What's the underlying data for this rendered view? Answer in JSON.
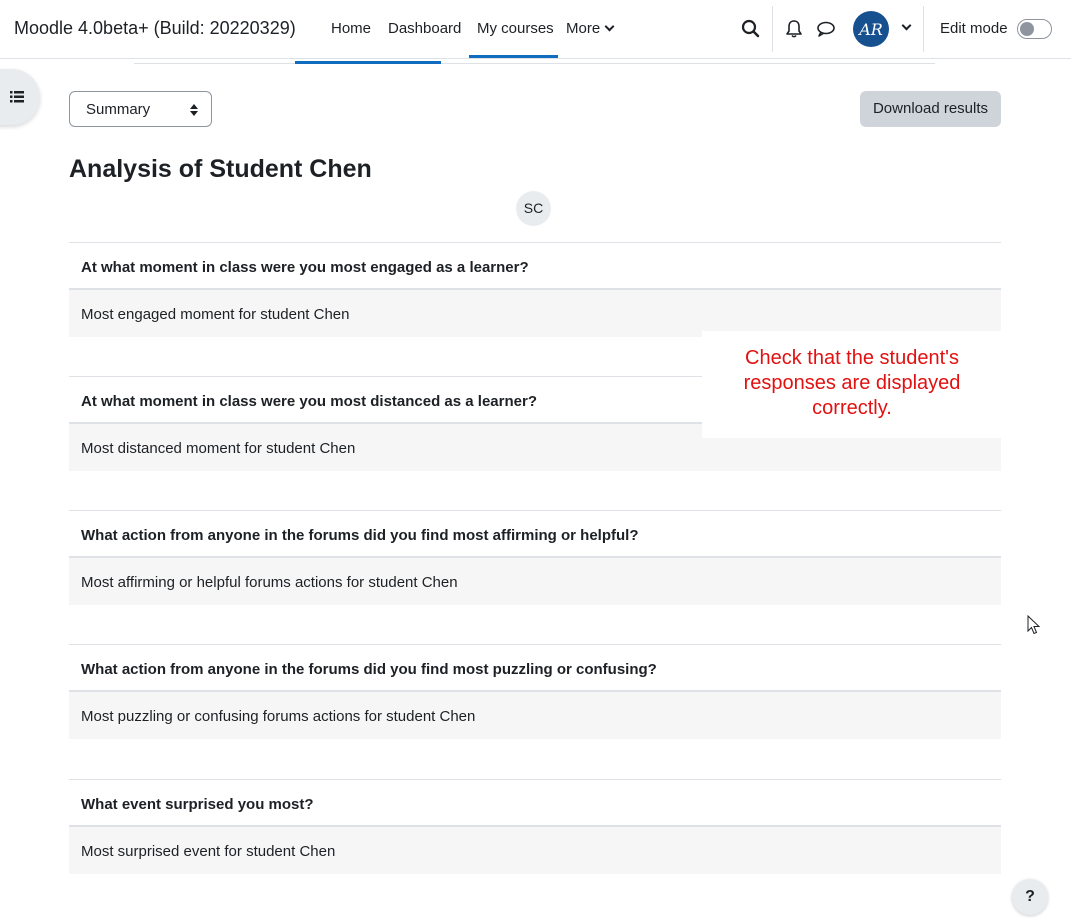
{
  "navbar": {
    "brand": "Moodle 4.0beta+ (Build: 20220329)",
    "links": [
      "Home",
      "Dashboard",
      "My courses",
      "More"
    ],
    "active_link": "My courses",
    "avatar_initials": "AR",
    "edit_mode_label": "Edit mode",
    "edit_mode_on": false
  },
  "controls": {
    "view_select": "Summary",
    "download_label": "Download results"
  },
  "page": {
    "title": "Analysis of Student Chen",
    "student_initials": "SC"
  },
  "responses": [
    {
      "question": "At what moment in class were you most engaged as a learner?",
      "answer": "Most engaged moment for student Chen"
    },
    {
      "question": "At what moment in class were you most distanced as a learner?",
      "answer": "Most distanced moment for student Chen"
    },
    {
      "question": "What action from anyone in the forums did you find most affirming or helpful?",
      "answer": "Most affirming or helpful forums actions for student Chen"
    },
    {
      "question": "What action from anyone in the forums did you find most puzzling or confusing?",
      "answer": "Most puzzling or confusing forums actions for student Chen"
    },
    {
      "question": "What event surprised you most?",
      "answer": "Most surprised event for student Chen"
    }
  ],
  "annotation": {
    "text": "Check that the student's responses are displayed correctly.",
    "color": "#e21010"
  },
  "help_label": "?",
  "colors": {
    "primary": "#0f6cbf",
    "button_secondary": "#ced4da",
    "answer_bg": "#f6f6f6"
  }
}
